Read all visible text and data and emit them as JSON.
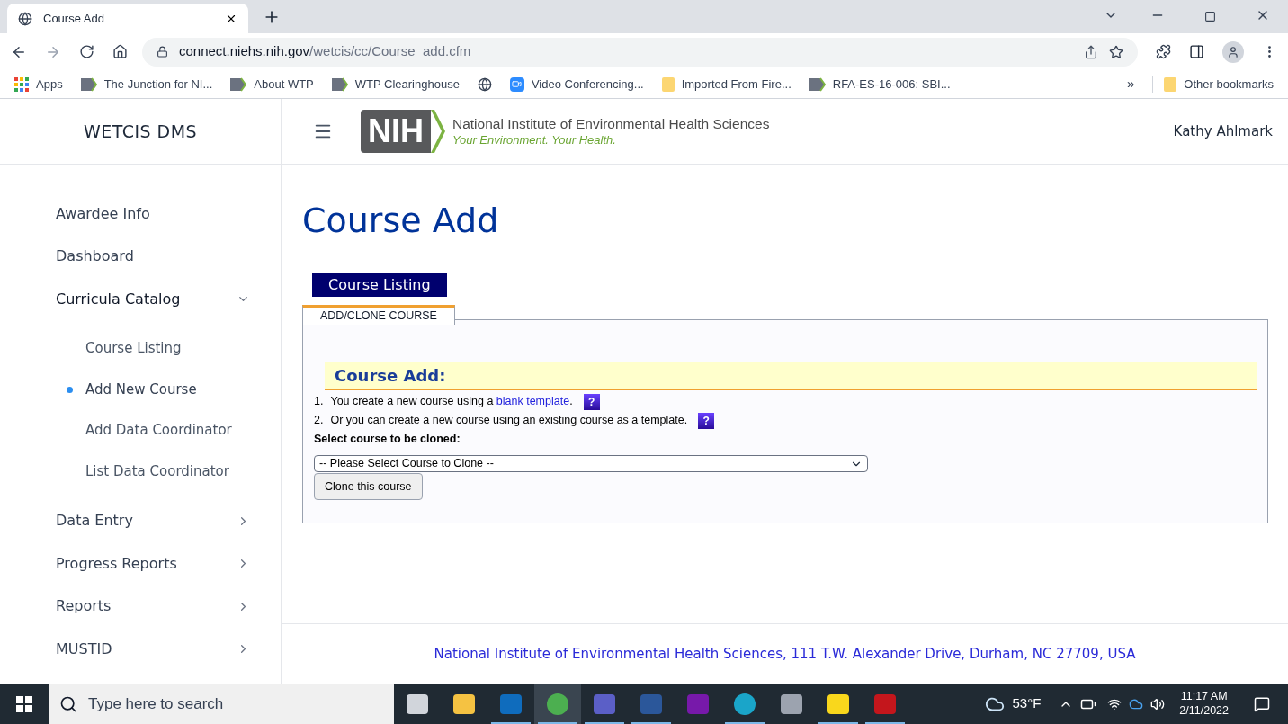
{
  "browser": {
    "tab_title": "Course Add",
    "url_host": "connect.niehs.nih.gov",
    "url_path": "/wetcis/cc/Course_add.cfm",
    "bookmarks": [
      {
        "label": "Apps",
        "kind": "grid"
      },
      {
        "label": "The Junction for NI...",
        "kind": "page"
      },
      {
        "label": "About WTP",
        "kind": "page"
      },
      {
        "label": "WTP Clearinghouse",
        "kind": "page"
      },
      {
        "kind": "globe"
      },
      {
        "label": "Video Conferencing...",
        "kind": "video"
      },
      {
        "label": "Imported From Fire...",
        "kind": "folder"
      },
      {
        "label": "RFA-ES-16-006: SBI...",
        "kind": "page"
      }
    ],
    "overflow": "»",
    "other_bookmarks": "Other bookmarks"
  },
  "app": {
    "brand": "WETCIS DMS",
    "org_name": "National Institute of Environmental Health Sciences",
    "org_tagline": "Your Environment. Your Health.",
    "logo_text": "NIH",
    "user": "Kathy Ahlmark"
  },
  "sidebar": {
    "items": [
      {
        "label": "Awardee Info",
        "kind": "link"
      },
      {
        "label": "Dashboard",
        "kind": "link"
      },
      {
        "label": "Curricula Catalog",
        "kind": "group",
        "expanded": true,
        "children": [
          {
            "label": "Course Listing",
            "selected": false
          },
          {
            "label": "Add New Course",
            "selected": true
          },
          {
            "label": "Add Data Coordinator",
            "selected": false
          },
          {
            "label": "List Data Coordinator",
            "selected": false
          }
        ]
      },
      {
        "label": "Data Entry",
        "kind": "group",
        "expanded": false
      },
      {
        "label": "Progress Reports",
        "kind": "group",
        "expanded": false
      },
      {
        "label": "Reports",
        "kind": "group",
        "expanded": false
      },
      {
        "label": "MUSTID",
        "kind": "group",
        "expanded": false
      }
    ]
  },
  "page": {
    "title": "Course Add",
    "listing_button": "Course Listing",
    "tabs": [
      {
        "label": "ADD/CLONE COURSE",
        "selected": true
      }
    ],
    "section_title": "Course Add:",
    "steps": [
      {
        "number": "1.",
        "text": "You create a new course using a ",
        "link": "blank template",
        "after": "."
      },
      {
        "number": "2.",
        "text": "Or you can create a new course using an existing course as a template."
      }
    ],
    "help_mark": "?",
    "select_label": "Select course to be cloned:",
    "select_value": "-- Please Select Course to Clone --",
    "clone_button": "Clone this course"
  },
  "footer": "National Institute of Environmental Health Sciences, 111 T.W. Alexander Drive, Durham, NC 27709, USA",
  "taskbar": {
    "search_placeholder": "Type here to search",
    "apps": [
      {
        "kind": "taskview",
        "selected": false,
        "running": false
      },
      {
        "kind": "explorer",
        "selected": false,
        "running": false
      },
      {
        "kind": "outlook",
        "selected": false,
        "running": true
      },
      {
        "kind": "chrome",
        "selected": true,
        "running": true
      },
      {
        "kind": "teams",
        "selected": false,
        "running": true
      },
      {
        "kind": "word",
        "selected": false,
        "running": true
      },
      {
        "kind": "onenote",
        "selected": false,
        "running": false
      },
      {
        "kind": "edge",
        "selected": false,
        "running": true
      },
      {
        "kind": "calculator",
        "selected": false,
        "running": false
      },
      {
        "kind": "sticky",
        "selected": false,
        "running": true
      },
      {
        "kind": "acrobat",
        "selected": false,
        "running": true
      }
    ],
    "weather": "53°F",
    "time": "11:17 AM",
    "date": "2/11/2022"
  }
}
